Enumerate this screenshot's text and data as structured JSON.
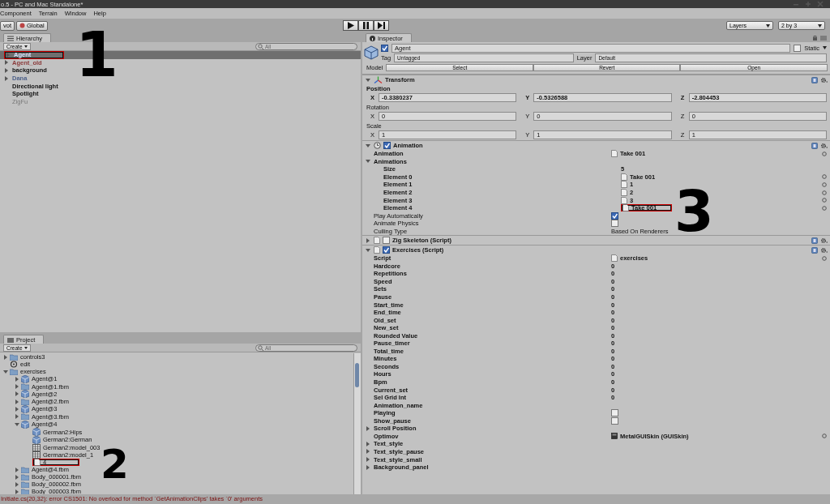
{
  "window": {
    "title": "o.5 - PC and Mac Standalone*"
  },
  "menu": [
    "Component",
    "Terrain",
    "Window",
    "Help"
  ],
  "toolbar": {
    "pivot": "vot",
    "global": "Global",
    "layers": "Layers",
    "layout": "2 by 3"
  },
  "hierarchy": {
    "tab": "Hierarchy",
    "create": "Create",
    "search_placeholder": "All",
    "items": [
      {
        "label": "Agent",
        "kind": "prefab",
        "expanded": false,
        "selected": true,
        "highlighted": true
      },
      {
        "label": "Agent_old",
        "kind": "broken",
        "expanded": false,
        "selected": false
      },
      {
        "label": "background",
        "kind": "plain",
        "expanded": false,
        "selected": false
      },
      {
        "label": "Dana",
        "kind": "prefab",
        "expanded": false,
        "selected": false
      },
      {
        "label": "Directional light",
        "kind": "plain",
        "selected": false
      },
      {
        "label": "Spotlight",
        "kind": "plain",
        "selected": false
      },
      {
        "label": "ZigFu",
        "kind": "inactive",
        "selected": false
      }
    ]
  },
  "project": {
    "tab": "Project",
    "create": "Create",
    "search_placeholder": "All",
    "items": [
      {
        "label": "controls3",
        "kind": "folder",
        "expanded": false
      },
      {
        "label": "edit",
        "kind": "scene"
      },
      {
        "label": "exercises",
        "kind": "folder",
        "expanded": true,
        "children": [
          {
            "label": "Agent@1",
            "kind": "model",
            "expanded": false
          },
          {
            "label": "Agent@1.fbm",
            "kind": "folder",
            "expanded": false
          },
          {
            "label": "Agent@2",
            "kind": "model",
            "expanded": false
          },
          {
            "label": "Agent@2.fbm",
            "kind": "folder",
            "expanded": false
          },
          {
            "label": "Agent@3",
            "kind": "model",
            "expanded": false
          },
          {
            "label": "Agent@3.fbm",
            "kind": "folder",
            "expanded": false
          },
          {
            "label": "Agent@4",
            "kind": "model",
            "expanded": true,
            "children": [
              {
                "label": "German2:Hips",
                "kind": "model"
              },
              {
                "label": "German2:German",
                "kind": "model"
              },
              {
                "label": "German2:model_003",
                "kind": "mesh"
              },
              {
                "label": "German2:model_1",
                "kind": "mesh"
              },
              {
                "label": "4",
                "kind": "clip",
                "highlighted": true
              }
            ]
          },
          {
            "label": "Agent@4.fbm",
            "kind": "folder",
            "expanded": false
          },
          {
            "label": "Body_000001.fbm",
            "kind": "folder",
            "expanded": false
          },
          {
            "label": "Body_000002.fbm",
            "kind": "folder",
            "expanded": false
          },
          {
            "label": "Body_000003.fbm",
            "kind": "folder",
            "expanded": false
          }
        ]
      }
    ]
  },
  "inspector": {
    "tab": "Inspector",
    "object": {
      "active": true,
      "name": "Agent",
      "static": false,
      "static_label": "Static",
      "tag_label": "Tag",
      "tag": "Untagged",
      "layer_label": "Layer",
      "layer": "Default",
      "model_label": "Model",
      "model_buttons": [
        "Select",
        "Revert",
        "Open"
      ]
    },
    "components": [
      {
        "kind": "transform",
        "title": "Transform",
        "expanded": true,
        "groups": [
          {
            "label": "Position",
            "modified": true,
            "axes": [
              {
                "axis": "X",
                "value": "-0.3380237"
              },
              {
                "axis": "Y",
                "value": "-0.5326588"
              },
              {
                "axis": "Z",
                "value": "-2.804453"
              }
            ]
          },
          {
            "label": "Rotation",
            "modified": false,
            "axes": [
              {
                "axis": "X",
                "value": "0"
              },
              {
                "axis": "Y",
                "value": "0"
              },
              {
                "axis": "Z",
                "value": "0"
              }
            ]
          },
          {
            "label": "Scale",
            "modified": false,
            "axes": [
              {
                "axis": "X",
                "value": "1"
              },
              {
                "axis": "Y",
                "value": "1"
              },
              {
                "axis": "Z",
                "value": "1"
              }
            ]
          }
        ]
      },
      {
        "kind": "animation",
        "title": "Animation",
        "enabled": true,
        "expanded": true,
        "props": [
          {
            "label": "Animation",
            "kind": "clip",
            "value": "Take 001",
            "modified": true
          },
          {
            "label": "Animations",
            "kind": "foldout",
            "expanded": true,
            "modified": true,
            "children": [
              {
                "label": "Size",
                "kind": "text",
                "value": "5",
                "modified": true
              },
              {
                "label": "Element 0",
                "kind": "clip",
                "value": "Take 001",
                "modified": true
              },
              {
                "label": "Element 1",
                "kind": "clip",
                "value": "1",
                "modified": true
              },
              {
                "label": "Element 2",
                "kind": "clip",
                "value": "2",
                "modified": true
              },
              {
                "label": "Element 3",
                "kind": "clip",
                "value": "3",
                "modified": true
              },
              {
                "label": "Element 4",
                "kind": "clip",
                "value": "Take 001",
                "modified": true,
                "highlighted": true
              }
            ]
          },
          {
            "label": "Play Automatically",
            "kind": "checkbox",
            "checked": true,
            "modified": false
          },
          {
            "label": "Animate Physics",
            "kind": "checkbox",
            "checked": false,
            "modified": false
          },
          {
            "label": "Culling Type",
            "kind": "text",
            "value": "Based On Renderers",
            "modified": false
          }
        ]
      },
      {
        "kind": "script",
        "title": "Zig Skeleton (Script)",
        "enabled": false,
        "expanded": false
      },
      {
        "kind": "script",
        "title": "Exercises (Script)",
        "enabled": true,
        "expanded": true,
        "props": [
          {
            "label": "Script",
            "kind": "script",
            "value": "exercises",
            "modified": true
          },
          {
            "label": "Hardcore",
            "kind": "text",
            "value": "0",
            "modified": true
          },
          {
            "label": "Repetitions",
            "kind": "text",
            "value": "0",
            "modified": true
          },
          {
            "label": "Speed",
            "kind": "text",
            "value": "0",
            "modified": true
          },
          {
            "label": "Sets",
            "kind": "text",
            "value": "0",
            "modified": true
          },
          {
            "label": "Pause",
            "kind": "text",
            "value": "0",
            "modified": true
          },
          {
            "label": "Start_time",
            "kind": "text",
            "value": "0",
            "modified": true
          },
          {
            "label": "End_time",
            "kind": "text",
            "value": "0",
            "modified": true
          },
          {
            "label": "Old_set",
            "kind": "text",
            "value": "0",
            "modified": true
          },
          {
            "label": "New_set",
            "kind": "text",
            "value": "0",
            "modified": true
          },
          {
            "label": "Rounded Value",
            "kind": "text",
            "value": "0",
            "modified": true
          },
          {
            "label": "Pause_timer",
            "kind": "text",
            "value": "0",
            "modified": true
          },
          {
            "label": "Total_time",
            "kind": "text",
            "value": "0",
            "modified": true
          },
          {
            "label": "Minutes",
            "kind": "text",
            "value": "0",
            "modified": true
          },
          {
            "label": "Seconds",
            "kind": "text",
            "value": "0",
            "modified": true
          },
          {
            "label": "Hours",
            "kind": "text",
            "value": "0",
            "modified": true
          },
          {
            "label": "Bpm",
            "kind": "text",
            "value": "0",
            "modified": true
          },
          {
            "label": "Current_set",
            "kind": "text",
            "value": "0",
            "modified": true
          },
          {
            "label": "Sel Grid Int",
            "kind": "text",
            "value": "0",
            "modified": true
          },
          {
            "label": "Animation_name",
            "kind": "text",
            "modified": true
          },
          {
            "label": "Playing",
            "kind": "checkbox",
            "checked": false,
            "modified": true
          },
          {
            "label": "Show_pause",
            "kind": "checkbox",
            "checked": false,
            "modified": true
          },
          {
            "label": "Scroll Position",
            "kind": "foldout",
            "expanded": false,
            "modified": true
          },
          {
            "label": "Optimov",
            "kind": "skin",
            "value": "MetalGUISkin (GUISkin)",
            "modified": true
          },
          {
            "label": "Text_style",
            "kind": "foldout",
            "expanded": false,
            "modified": true
          },
          {
            "label": "Text_style_pause",
            "kind": "foldout",
            "expanded": false,
            "modified": true
          },
          {
            "label": "Text_style_small",
            "kind": "foldout",
            "expanded": false,
            "modified": true
          },
          {
            "label": "Background_panel",
            "kind": "foldout",
            "expanded": false,
            "modified": true
          }
        ]
      }
    ]
  },
  "status_bar": "Initiate.cs(20,32): error CS1501: No overload for method `GetAnimationClips' takes `0' arguments",
  "annotations": [
    {
      "label": "1"
    },
    {
      "label": "2"
    },
    {
      "label": "3"
    }
  ]
}
